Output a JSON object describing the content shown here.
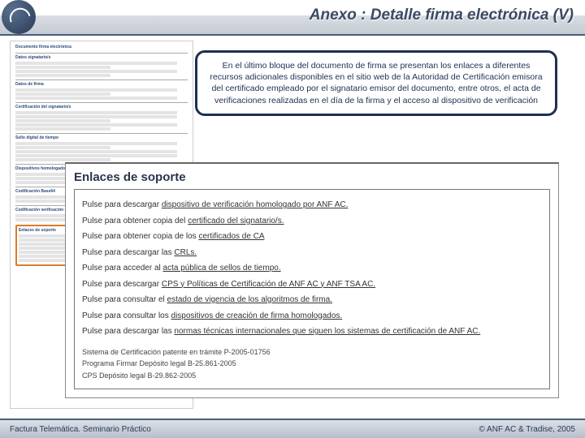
{
  "header": {
    "title": "Anexo : Detalle firma electrónica (V)"
  },
  "callout": {
    "text": "En el último bloque del documento de firma se presentan los enlaces a diferentes recursos adicionales disponibles en el sitio web de la Autoridad de Certificación emisora del certificado empleado por el signatario emisor del documento, entre otros, el acta de verificaciones realizadas en el día de la firma y el acceso al dispositivo de verificación"
  },
  "doc": {
    "title": "Documento firma electrónica",
    "sections": [
      "Datos signatario/s",
      "Datos de firma",
      "Certificación del signatario/s",
      "Sello digital de tiempo",
      "Dispositivos homologados",
      "Codificación Base64",
      "Codificación verificación certificado de firma",
      "Enlaces de soporte"
    ]
  },
  "panel": {
    "heading": "Enlaces de soporte",
    "links": [
      {
        "prefix": "Pulse para descargar ",
        "link": "dispositivo de verificación homologado por ANF AC."
      },
      {
        "prefix": "Pulse para obtener copia del ",
        "link": "certificado del signatario/s."
      },
      {
        "prefix": "Pulse para obtener copia de los ",
        "link": "certificados de CA"
      },
      {
        "prefix": "Pulse para descargar las ",
        "link": "CRLs."
      },
      {
        "prefix": "Pulse para acceder al ",
        "link": "acta pública de sellos de tiempo."
      },
      {
        "prefix": "Pulse para descargar ",
        "link": "CPS y Políticas de Certificación de ANF AC y ANF TSA AC."
      },
      {
        "prefix": "Pulse para consultar el ",
        "link": "estado de vigencia de los algoritmos de firma."
      },
      {
        "prefix": "Pulse para consultar los ",
        "link": "dispositivos de creación de firma homologados."
      },
      {
        "prefix": "Pulse para descargar las ",
        "link": "normas técnicas internacionales que siguen los sistemas de certificación de ANF AC."
      }
    ],
    "footnotes": [
      "Sistema de Certificación patente en trámite P-2005-01756",
      "Programa Firmar Depósito legal B-25.861-2005",
      "CPS Depósito legal B-29.862-2005"
    ]
  },
  "footer": {
    "left": "Factura Telemática. Seminario Práctico",
    "right": "© ANF AC & Tradise, 2005"
  }
}
